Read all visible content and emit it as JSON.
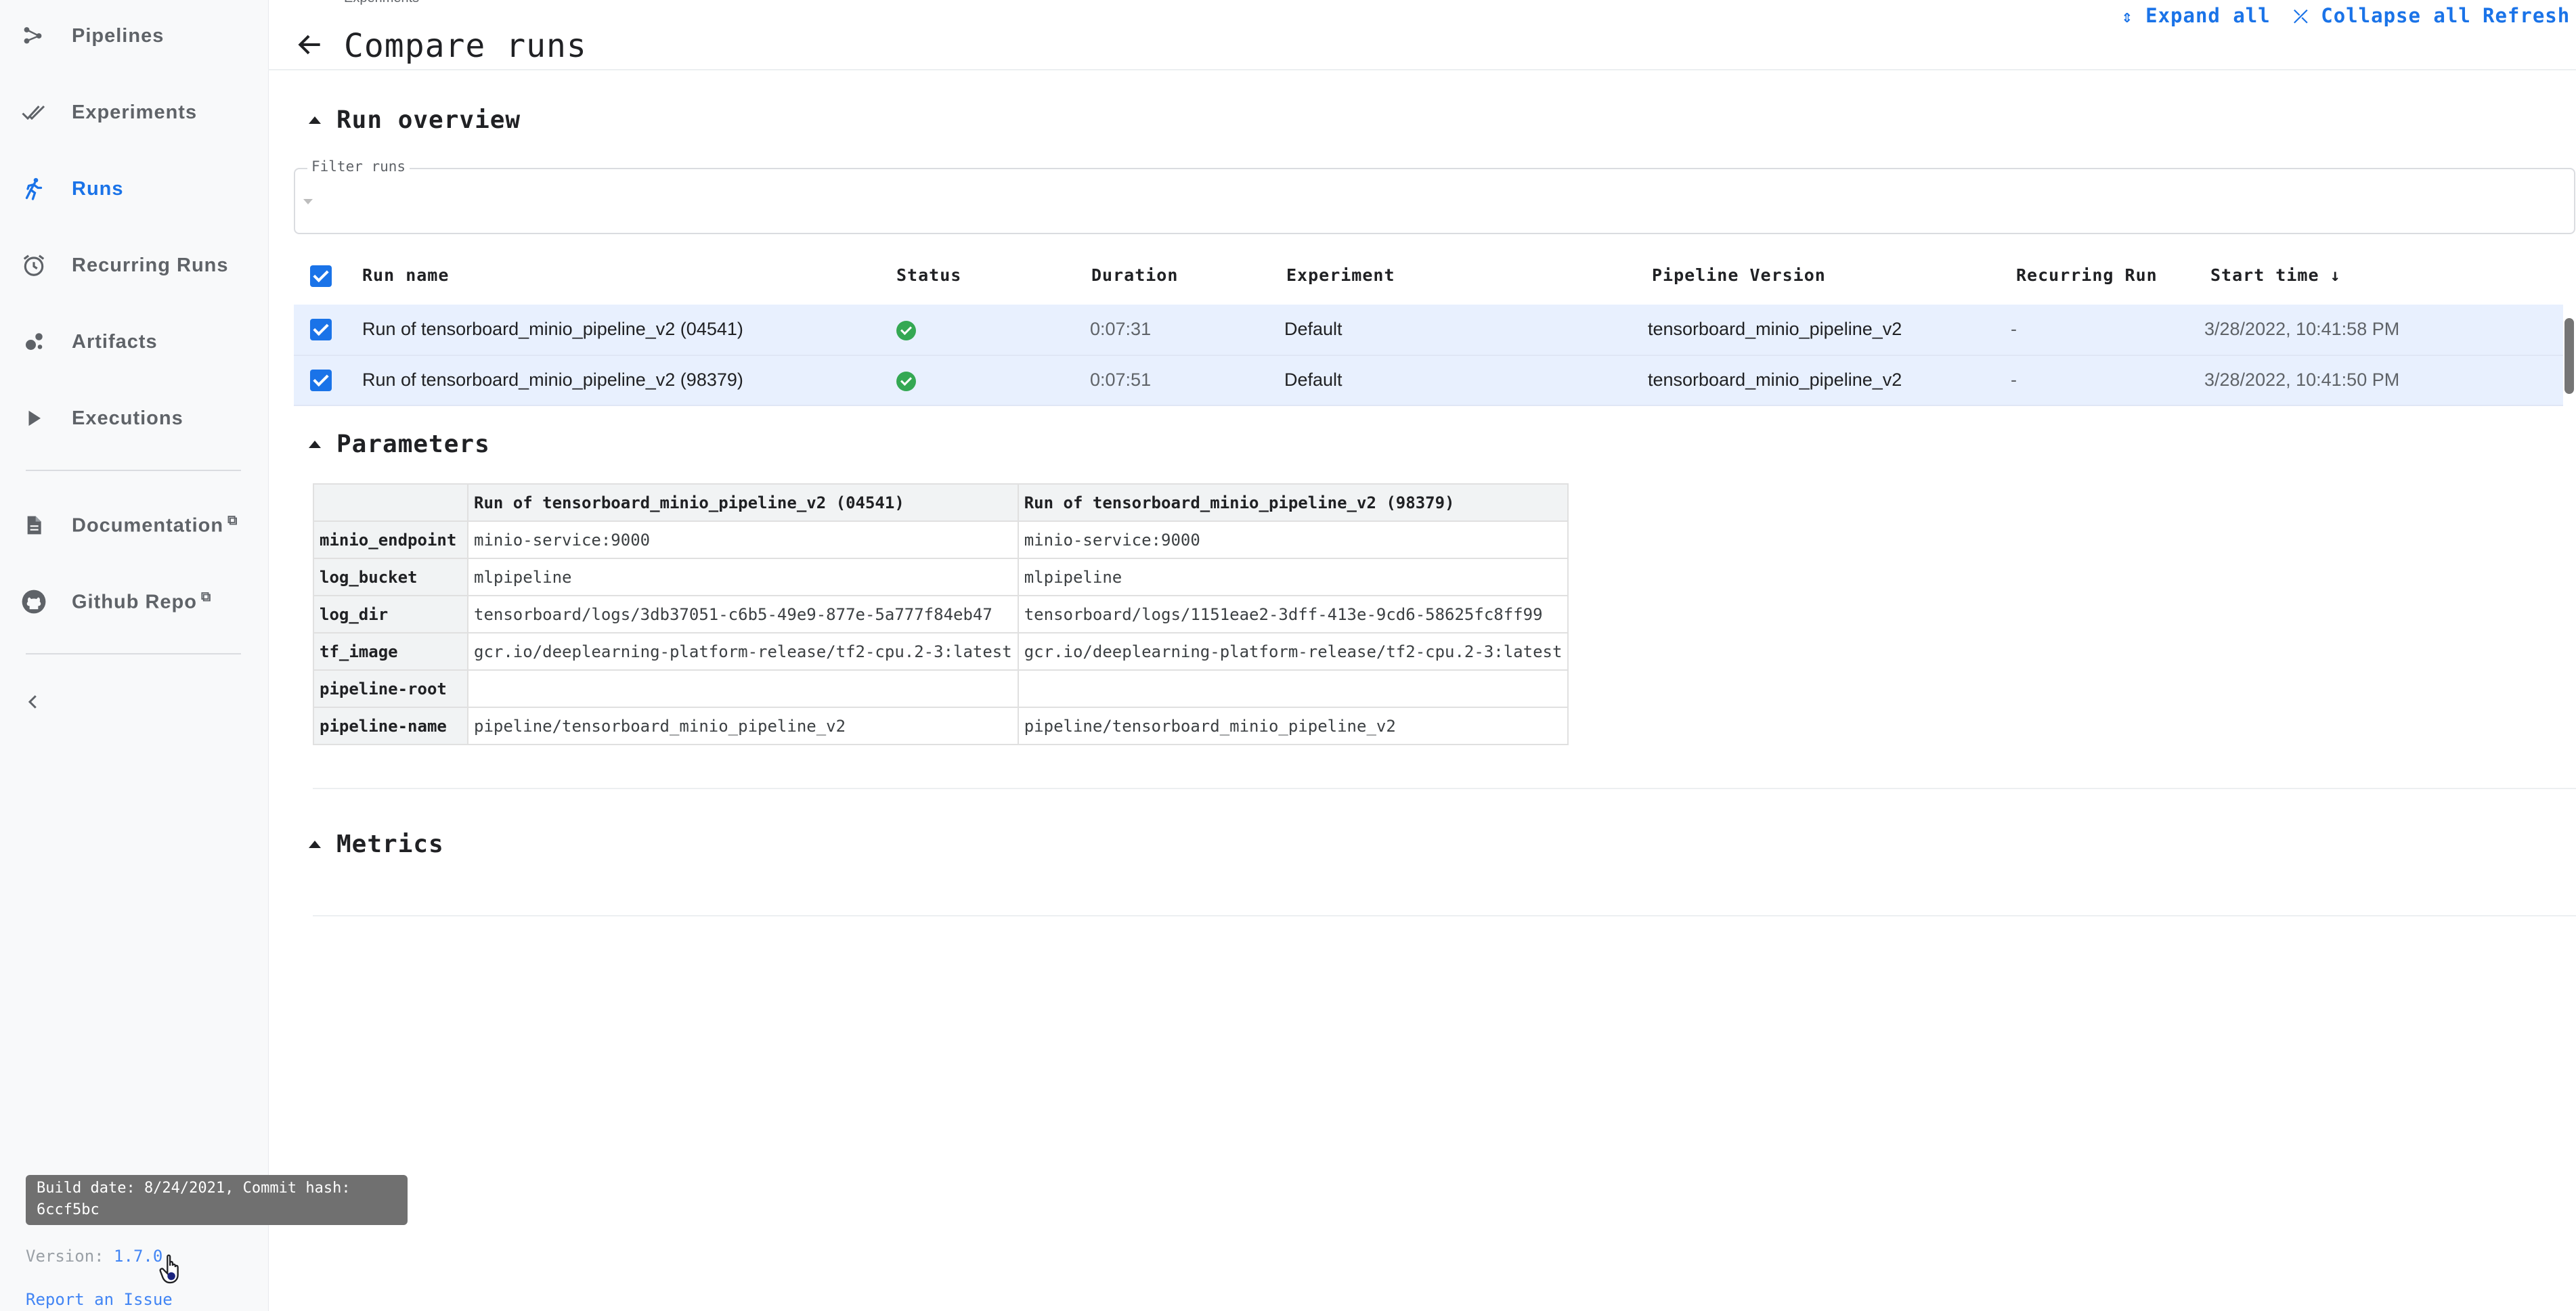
{
  "sidebar": {
    "items": [
      {
        "label": "Pipelines",
        "icon": "pipelines-icon",
        "active": false
      },
      {
        "label": "Experiments",
        "icon": "experiments-icon",
        "active": false
      },
      {
        "label": "Runs",
        "icon": "runs-icon",
        "active": true
      },
      {
        "label": "Recurring Runs",
        "icon": "alarm-icon",
        "active": false
      },
      {
        "label": "Artifacts",
        "icon": "artifacts-icon",
        "active": false
      },
      {
        "label": "Executions",
        "icon": "play-icon",
        "active": false
      }
    ],
    "links": [
      {
        "label": "Documentation",
        "icon": "document-icon"
      },
      {
        "label": "Github Repo",
        "icon": "github-icon"
      }
    ],
    "tooltip": "Build date: 8/24/2021, Commit hash: 6ccf5bc",
    "version_label": "Version:",
    "version_value": "1.7.0",
    "report_issue": "Report an Issue"
  },
  "header": {
    "breadcrumb": "Experiments",
    "title": "Compare runs",
    "expand_all": "Expand all",
    "collapse_all": "Collapse all",
    "refresh": "Refresh"
  },
  "run_overview": {
    "title": "Run overview",
    "filter_label": "Filter runs",
    "filter_value": "",
    "columns": [
      "Run name",
      "Status",
      "Duration",
      "Experiment",
      "Pipeline Version",
      "Recurring Run",
      "Start time"
    ],
    "sort_indicator": "↓",
    "rows": [
      {
        "name": "Run of tensorboard_minio_pipeline_v2 (04541)",
        "status": "succeeded",
        "duration": "0:07:31",
        "experiment": "Default",
        "pipeline_version": "tensorboard_minio_pipeline_v2",
        "recurring_run": "-",
        "start_time": "3/28/2022, 10:41:58 PM"
      },
      {
        "name": "Run of tensorboard_minio_pipeline_v2 (98379)",
        "status": "succeeded",
        "duration": "0:07:51",
        "experiment": "Default",
        "pipeline_version": "tensorboard_minio_pipeline_v2",
        "recurring_run": "-",
        "start_time": "3/28/2022, 10:41:50 PM"
      }
    ]
  },
  "parameters": {
    "title": "Parameters",
    "headers": [
      "",
      "Run of tensorboard_minio_pipeline_v2 (04541)",
      "Run of tensorboard_minio_pipeline_v2 (98379)"
    ],
    "rows": [
      [
        "minio_endpoint",
        "minio-service:9000",
        "minio-service:9000"
      ],
      [
        "log_bucket",
        "mlpipeline",
        "mlpipeline"
      ],
      [
        "log_dir",
        "tensorboard/logs/3db37051-c6b5-49e9-877e-5a777f84eb47",
        "tensorboard/logs/1151eae2-3dff-413e-9cd6-58625fc8ff99"
      ],
      [
        "tf_image",
        "gcr.io/deeplearning-platform-release/tf2-cpu.2-3:latest",
        "gcr.io/deeplearning-platform-release/tf2-cpu.2-3:latest"
      ],
      [
        "pipeline-root",
        "",
        ""
      ],
      [
        "pipeline-name",
        "pipeline/tensorboard_minio_pipeline_v2",
        "pipeline/tensorboard_minio_pipeline_v2"
      ]
    ]
  },
  "metrics": {
    "title": "Metrics"
  },
  "colors": {
    "accent": "#1a73e8",
    "success": "#34a853",
    "row_selected": "#e8f0fe"
  }
}
